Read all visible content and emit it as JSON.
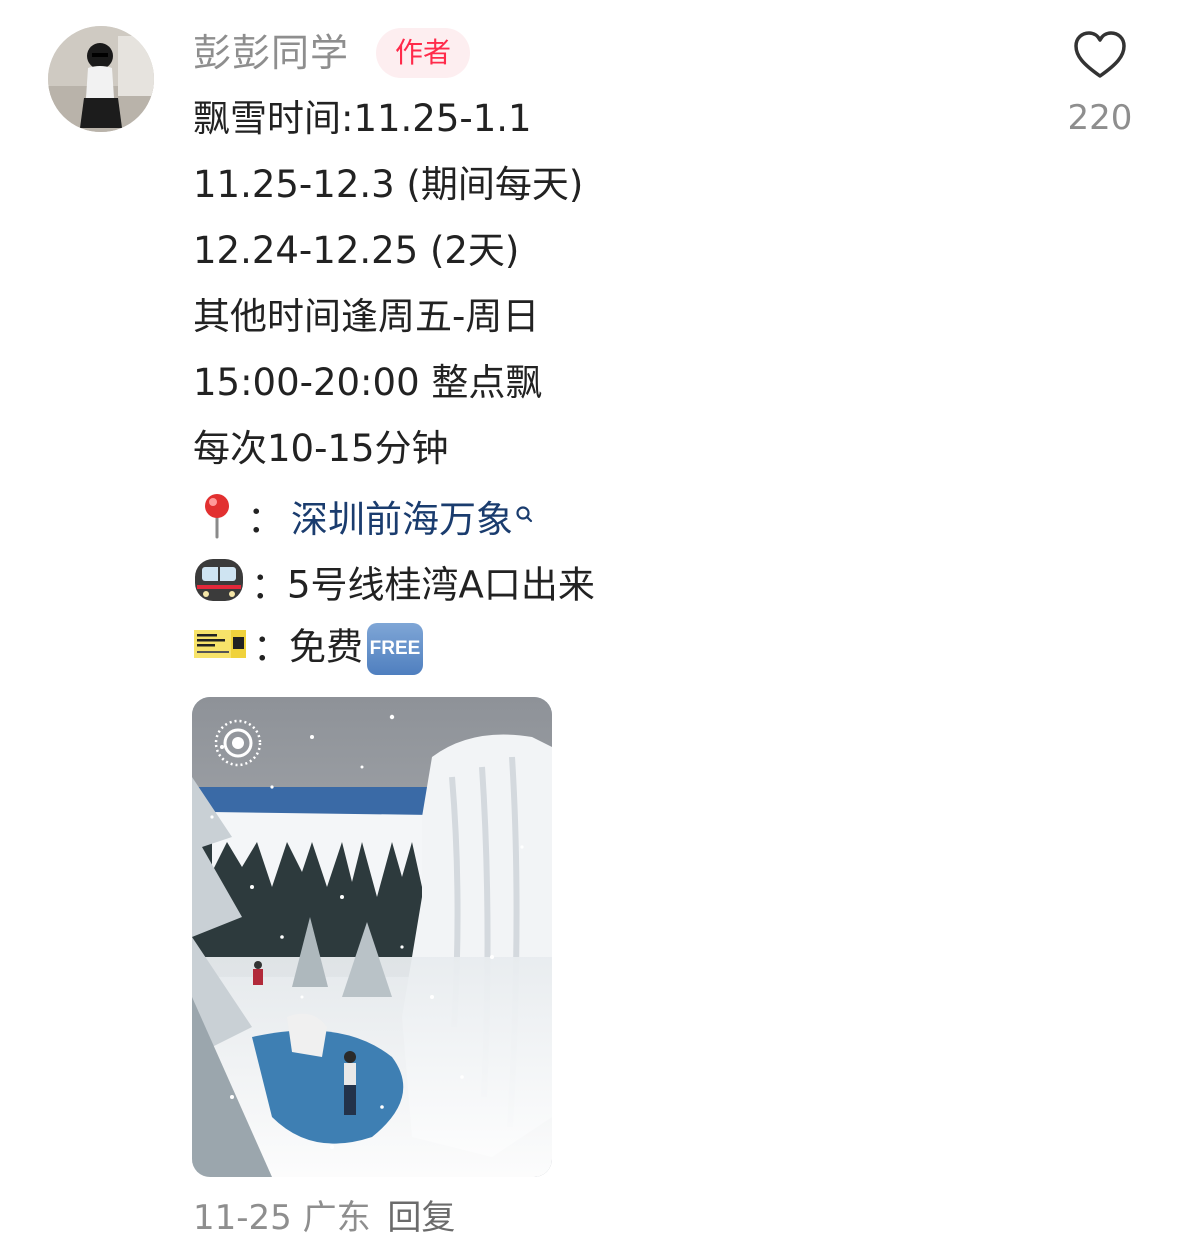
{
  "comment": {
    "author": {
      "name": "彭彭同学",
      "badge": "作者"
    },
    "like_count": "220",
    "lines": [
      "飘雪时间:11.25-1.1",
      "11.25-12.3 (期间每天)",
      "12.24-12.25 (2天)",
      "其他时间逢周五-周日",
      "15:00-20:00 整点飘",
      "每次10-15分钟"
    ],
    "location": {
      "icon": "round-pushpin-icon",
      "colon": "：",
      "text": "深圳前海万象"
    },
    "metro": {
      "icon": "metro-train-icon",
      "colon": "：",
      "text": "5号线桂湾A口出来"
    },
    "ticket": {
      "icon": "ticket-icon",
      "colon": "：",
      "text": "免费",
      "free_badge": "FREE"
    },
    "footer": {
      "date": "11-25",
      "region": "广东",
      "reply": "回复"
    }
  },
  "colors": {
    "accent_red": "#ff2a4a",
    "badge_bg": "#fdeef0",
    "link_blue": "#1a3c6e",
    "muted_gray": "#8e8e8e"
  }
}
